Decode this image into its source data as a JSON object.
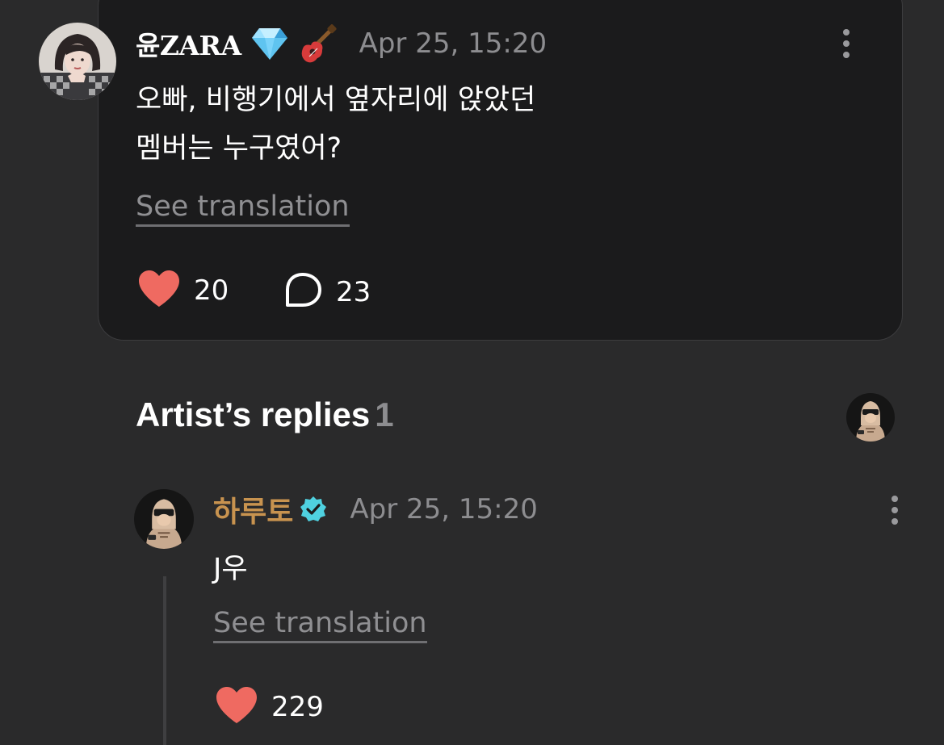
{
  "post": {
    "author_name": "윤ZARA",
    "timestamp": "Apr 25, 15:20",
    "text_lines": [
      "오빠, 비행기에서 옆자리에 앉았던",
      "멤버는 누구였어?"
    ],
    "see_translation": "See translation",
    "likes": "20",
    "comments": "23",
    "emoji_icons": [
      "gem-icon",
      "guitar-icon"
    ]
  },
  "replies": {
    "header_label": "Artist’s replies",
    "count": "1"
  },
  "reply": {
    "author_name": "하루토",
    "timestamp": "Apr 25, 15:20",
    "text": "J우",
    "see_translation": "See translation",
    "likes": "229"
  },
  "colors": {
    "background": "#2a2a2b",
    "card": "#1b1b1c",
    "heart": "#ef6a61",
    "artist_name": "#c8934f",
    "verified": "#4fd1e0",
    "muted": "#8d8d90"
  }
}
